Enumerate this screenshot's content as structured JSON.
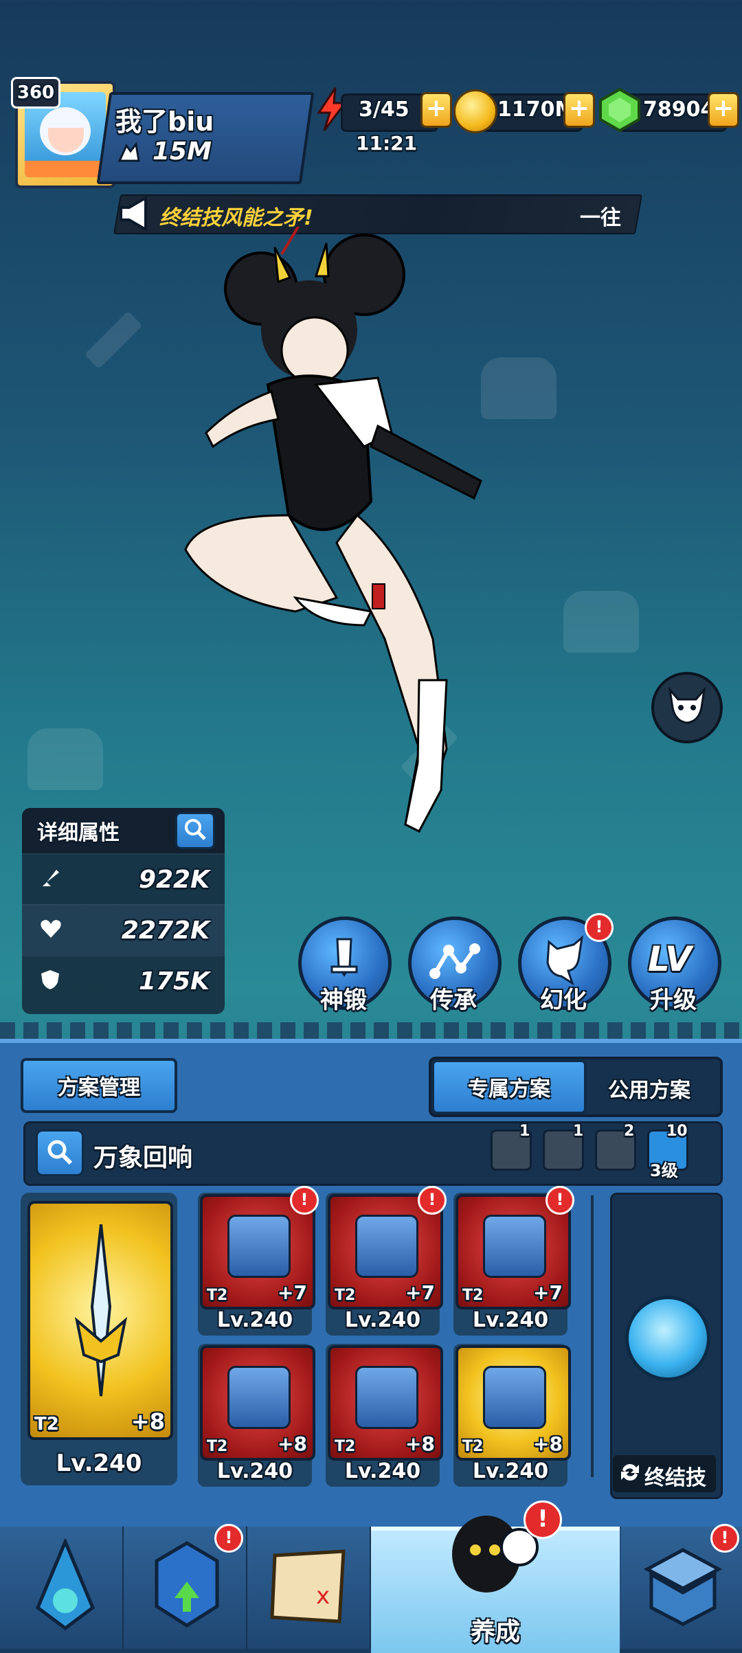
{
  "player": {
    "level": "360",
    "name": "我了biu",
    "power": "15M"
  },
  "resources": {
    "energy": "3/45",
    "energy_timer": "11:21",
    "gold": "1170M",
    "gems": "78904"
  },
  "banner": {
    "text_left": "终结技风能之矛!",
    "text_right": "一往"
  },
  "stats": {
    "title": "详细属性",
    "rows": [
      {
        "icon": "sword-icon",
        "value": "922K"
      },
      {
        "icon": "heart-icon",
        "value": "2272K"
      },
      {
        "icon": "shield-icon",
        "value": "175K"
      }
    ]
  },
  "actions": [
    {
      "label": "神锻",
      "icon": "sword-icon"
    },
    {
      "label": "传承",
      "icon": "nodes-icon"
    },
    {
      "label": "幻化",
      "icon": "dragon-icon"
    },
    {
      "label": "升级",
      "icon": "level-up-icon",
      "glyph": "LV"
    }
  ],
  "plan": {
    "manage_label": "方案管理",
    "tabs": [
      "专属方案",
      "公用方案"
    ],
    "set_name": "万象回响",
    "set_counts": [
      {
        "icon": "lightning-icon",
        "count": "1"
      },
      {
        "icon": "tornado-icon",
        "count": "1"
      },
      {
        "icon": "flame-icon",
        "count": "2"
      },
      {
        "icon": "ice-icon",
        "count": "10",
        "sub": "3级"
      }
    ]
  },
  "weapon": {
    "tier": "T2",
    "plus": "+8",
    "level": "Lv.240"
  },
  "gear": [
    {
      "tier": "T2",
      "plus": "+7",
      "level": "Lv.240",
      "rarity": "red",
      "icon": "helmet-icon",
      "alert": "!"
    },
    {
      "tier": "T2",
      "plus": "+7",
      "level": "Lv.240",
      "rarity": "red",
      "icon": "chest-armor-icon",
      "alert": "!"
    },
    {
      "tier": "T2",
      "plus": "+7",
      "level": "Lv.240",
      "rarity": "red",
      "icon": "pauldron-icon",
      "alert": "!"
    },
    {
      "tier": "T2",
      "plus": "+8",
      "level": "Lv.240",
      "rarity": "red",
      "icon": "gauntlet-icon"
    },
    {
      "tier": "T2",
      "plus": "+8",
      "level": "Lv.240",
      "rarity": "red",
      "icon": "boots-icon"
    },
    {
      "tier": "T2",
      "plus": "+8",
      "level": "Lv.240",
      "rarity": "gold",
      "icon": "necklace-icon"
    }
  ],
  "ultimate": {
    "label": "终结技"
  },
  "nav": [
    {
      "label": "",
      "icon": "crystal-icon"
    },
    {
      "label": "",
      "icon": "upgrade-gem-icon",
      "alert": "!"
    },
    {
      "label": "",
      "icon": "map-icon"
    },
    {
      "label": "养成",
      "icon": "hero-icon",
      "alert": "!",
      "active": true
    },
    {
      "label": "",
      "icon": "shop-icon",
      "alert": "!"
    }
  ]
}
